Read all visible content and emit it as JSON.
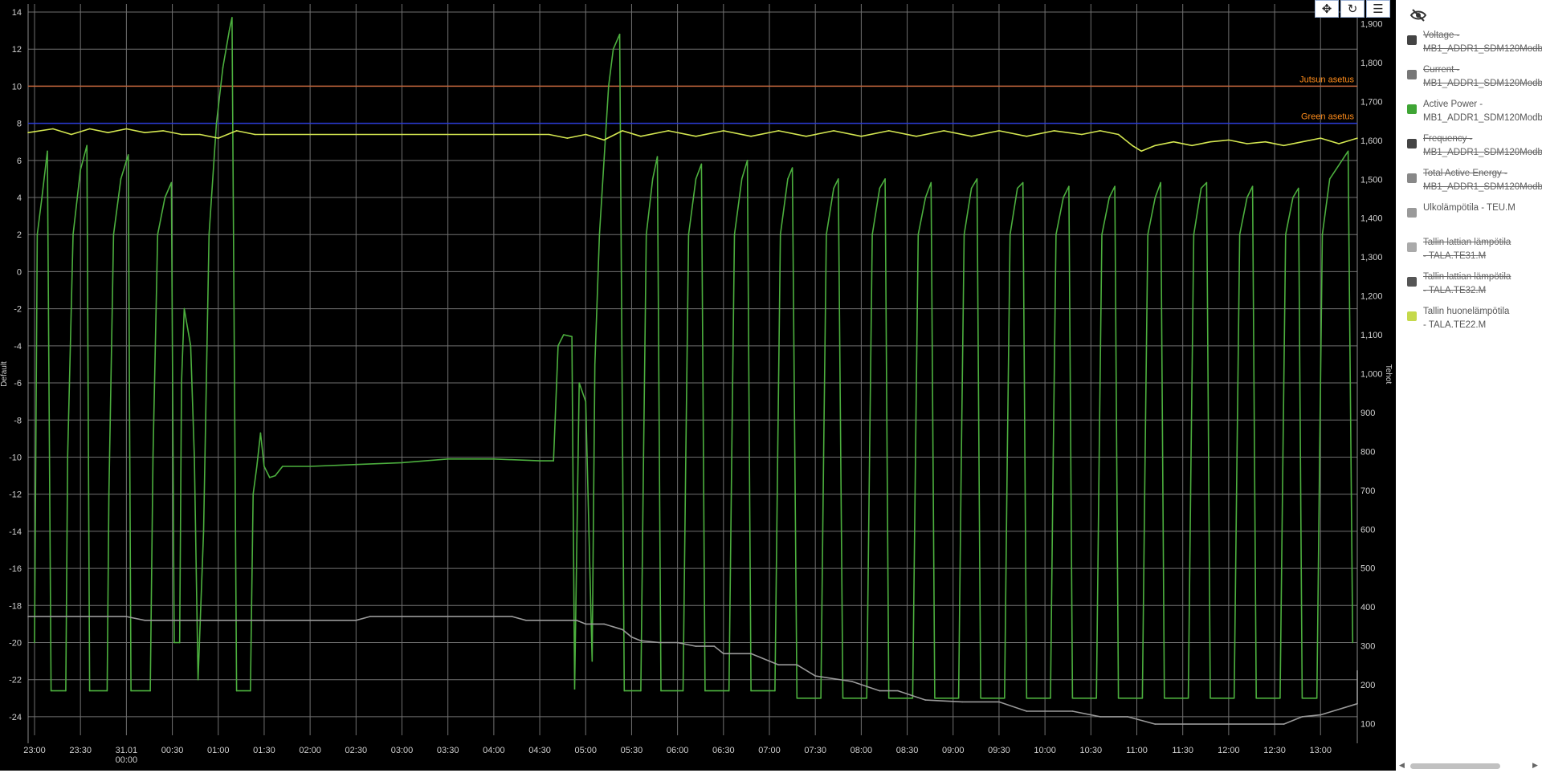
{
  "toolbar": {
    "pan_icon": "move-arrows-icon",
    "reset_icon": "refresh-icon",
    "menu_icon": "hamburger-menu-icon"
  },
  "legend": {
    "toggle_icon": "eye-slash-icon",
    "items": [
      {
        "line1": "Voltage -",
        "line2": "MB1_ADDR1_SDM120Modbus",
        "color": "#444444",
        "hidden": true
      },
      {
        "line1": "Current -",
        "line2": "MB1_ADDR1_SDM120Modbus",
        "color": "#777777",
        "hidden": true
      },
      {
        "line1": "Active Power -",
        "line2": "MB1_ADDR1_SDM120Modbus",
        "color": "#3fa535",
        "hidden": false
      },
      {
        "line1": "Frequency -",
        "line2": "MB1_ADDR1_SDM120Modbus",
        "color": "#444444",
        "hidden": true
      },
      {
        "line1": "Total Active Energy -",
        "line2": "MB1_ADDR1_SDM120Modbus",
        "color": "#888888",
        "hidden": true
      },
      {
        "line1": "Ulkolämpötila - TEU.M",
        "line2": "",
        "color": "#9a9a9a",
        "hidden": false
      },
      {
        "line1": "Tallin lattian lämpötila",
        "line2": "- TALA.TE31.M",
        "color": "#aaaaaa",
        "hidden": true
      },
      {
        "line1": "Tallin lattian lämpötila",
        "line2": "- TALA.TE32.M",
        "color": "#555555",
        "hidden": true
      },
      {
        "line1": "Tallin huonelämpötila",
        "line2": "- TALA.TE22.M",
        "color": "#c5d94b",
        "hidden": false
      }
    ]
  },
  "chart_data": {
    "type": "line",
    "y_left": {
      "title": "Default",
      "ticks": [
        14,
        12,
        10,
        8,
        6,
        4,
        2,
        0,
        -2,
        -4,
        -6,
        -8,
        -10,
        -12,
        -14,
        -16,
        -18,
        -20,
        -22,
        -24
      ],
      "range": [
        -25,
        14
      ]
    },
    "y_right": {
      "title": "Tehot",
      "ticks": [
        1900,
        1800,
        1700,
        1600,
        1500,
        1400,
        1300,
        1200,
        1100,
        1000,
        900,
        800,
        700,
        600,
        500,
        400,
        300,
        200,
        100
      ],
      "range": [
        70,
        1930
      ]
    },
    "x": {
      "ticks": [
        "23:00",
        "23:30",
        "31.01|00:00",
        "00:30",
        "01:00",
        "01:30",
        "02:00",
        "02:30",
        "03:00",
        "03:30",
        "04:00",
        "04:30",
        "05:00",
        "05:30",
        "06:00",
        "06:30",
        "07:00",
        "07:30",
        "08:00",
        "08:30",
        "09:00",
        "09:30",
        "10:00",
        "10:30",
        "11:00",
        "11:30",
        "12:00",
        "12:30",
        "13:00"
      ],
      "range_hours": [
        -0.07,
        14.4
      ]
    },
    "grid": true,
    "legend_placement": "right",
    "plot_lines": [
      {
        "label": "Jutsun asetus",
        "value": 10,
        "color": "#c0643a"
      },
      {
        "label": "Green asetus",
        "value": 8,
        "color": "#2a3bd8"
      }
    ],
    "series": [
      {
        "name": "Active Power - MB1_ADDR1_SDM120Modbus",
        "axis": "left",
        "color": "#4caf3e",
        "points": [
          [
            0.0,
            -20
          ],
          [
            0.03,
            2
          ],
          [
            0.08,
            4
          ],
          [
            0.14,
            6.5
          ],
          [
            0.18,
            -22.6
          ],
          [
            0.34,
            -22.6
          ],
          [
            0.36,
            -10
          ],
          [
            0.42,
            2
          ],
          [
            0.5,
            5.5
          ],
          [
            0.57,
            6.8
          ],
          [
            0.6,
            -22.6
          ],
          [
            0.79,
            -22.6
          ],
          [
            0.81,
            -12
          ],
          [
            0.86,
            2
          ],
          [
            0.94,
            5
          ],
          [
            1.02,
            6.3
          ],
          [
            1.05,
            -22.6
          ],
          [
            1.26,
            -22.6
          ],
          [
            1.29,
            -10
          ],
          [
            1.34,
            2
          ],
          [
            1.42,
            4
          ],
          [
            1.49,
            4.8
          ],
          [
            1.52,
            -20
          ],
          [
            1.58,
            -20
          ],
          [
            1.6,
            -6
          ],
          [
            1.63,
            -2
          ],
          [
            1.7,
            -4
          ],
          [
            1.74,
            -10
          ],
          [
            1.78,
            -22
          ],
          [
            1.84,
            -14
          ],
          [
            1.9,
            2
          ],
          [
            1.98,
            8
          ],
          [
            2.05,
            11
          ],
          [
            2.12,
            13
          ],
          [
            2.15,
            13.7
          ],
          [
            2.2,
            -22.6
          ],
          [
            2.35,
            -22.6
          ],
          [
            2.38,
            -12
          ],
          [
            2.42,
            -10.5
          ],
          [
            2.46,
            -8.7
          ],
          [
            2.5,
            -10.5
          ],
          [
            2.56,
            -11.1
          ],
          [
            2.62,
            -11
          ],
          [
            2.7,
            -10.5
          ],
          [
            3.0,
            -10.5
          ],
          [
            3.5,
            -10.4
          ],
          [
            4.0,
            -10.3
          ],
          [
            4.5,
            -10.1
          ],
          [
            5.0,
            -10.1
          ],
          [
            5.5,
            -10.2
          ],
          [
            5.65,
            -10.2
          ],
          [
            5.7,
            -4
          ],
          [
            5.76,
            -3.4
          ],
          [
            5.85,
            -3.5
          ],
          [
            5.88,
            -22.5
          ],
          [
            5.93,
            -6
          ],
          [
            6.0,
            -7
          ],
          [
            6.07,
            -21
          ],
          [
            6.1,
            -5
          ],
          [
            6.15,
            2
          ],
          [
            6.2,
            6
          ],
          [
            6.25,
            10
          ],
          [
            6.3,
            12
          ],
          [
            6.37,
            12.8
          ],
          [
            6.42,
            -22.6
          ],
          [
            6.6,
            -22.6
          ],
          [
            6.63,
            -10
          ],
          [
            6.66,
            2
          ],
          [
            6.73,
            5
          ],
          [
            6.78,
            6.2
          ],
          [
            6.82,
            -22.6
          ],
          [
            7.06,
            -22.6
          ],
          [
            7.09,
            -10
          ],
          [
            7.12,
            2
          ],
          [
            7.2,
            5
          ],
          [
            7.26,
            5.8
          ],
          [
            7.3,
            -22.6
          ],
          [
            7.56,
            -22.6
          ],
          [
            7.59,
            -10
          ],
          [
            7.62,
            2
          ],
          [
            7.7,
            5
          ],
          [
            7.76,
            6.0
          ],
          [
            7.8,
            -22.6
          ],
          [
            8.06,
            -22.6
          ],
          [
            8.09,
            -10
          ],
          [
            8.12,
            2
          ],
          [
            8.2,
            5
          ],
          [
            8.25,
            5.6
          ],
          [
            8.3,
            -23
          ],
          [
            8.56,
            -23
          ],
          [
            8.59,
            -10
          ],
          [
            8.62,
            2
          ],
          [
            8.7,
            4.5
          ],
          [
            8.75,
            5
          ],
          [
            8.8,
            -23
          ],
          [
            9.06,
            -23
          ],
          [
            9.09,
            -10
          ],
          [
            9.12,
            2
          ],
          [
            9.2,
            4.5
          ],
          [
            9.26,
            5
          ],
          [
            9.3,
            -23
          ],
          [
            9.56,
            -23
          ],
          [
            9.59,
            -10
          ],
          [
            9.62,
            2
          ],
          [
            9.7,
            4
          ],
          [
            9.76,
            4.8
          ],
          [
            9.8,
            -23
          ],
          [
            10.06,
            -23
          ],
          [
            10.09,
            -10
          ],
          [
            10.12,
            2
          ],
          [
            10.2,
            4.5
          ],
          [
            10.26,
            5
          ],
          [
            10.3,
            -23
          ],
          [
            10.56,
            -23
          ],
          [
            10.59,
            -10
          ],
          [
            10.62,
            2
          ],
          [
            10.7,
            4.5
          ],
          [
            10.76,
            4.8
          ],
          [
            10.8,
            -23
          ],
          [
            11.06,
            -23
          ],
          [
            11.09,
            -10
          ],
          [
            11.12,
            2
          ],
          [
            11.2,
            4
          ],
          [
            11.26,
            4.6
          ],
          [
            11.3,
            -23
          ],
          [
            11.56,
            -23
          ],
          [
            11.59,
            -10
          ],
          [
            11.62,
            2
          ],
          [
            11.7,
            4
          ],
          [
            11.76,
            4.6
          ],
          [
            11.8,
            -23
          ],
          [
            12.06,
            -23
          ],
          [
            12.09,
            -10
          ],
          [
            12.12,
            2
          ],
          [
            12.2,
            4
          ],
          [
            12.26,
            4.8
          ],
          [
            12.3,
            -23
          ],
          [
            12.56,
            -23
          ],
          [
            12.59,
            -10
          ],
          [
            12.62,
            2
          ],
          [
            12.7,
            4.5
          ],
          [
            12.76,
            4.8
          ],
          [
            12.8,
            -23
          ],
          [
            13.06,
            -23
          ],
          [
            13.09,
            -10
          ],
          [
            13.12,
            2
          ],
          [
            13.2,
            4
          ],
          [
            13.26,
            4.6
          ],
          [
            13.3,
            -23
          ],
          [
            13.56,
            -23
          ],
          [
            13.59,
            -10
          ],
          [
            13.62,
            2
          ],
          [
            13.7,
            4
          ],
          [
            13.76,
            4.5
          ],
          [
            13.8,
            -23
          ],
          [
            13.96,
            -23
          ],
          [
            13.99,
            -10
          ],
          [
            14.02,
            2
          ],
          [
            14.1,
            5
          ],
          [
            14.3,
            6.5
          ],
          [
            14.35,
            -20
          ]
        ]
      },
      {
        "name": "Ulkolämpötila - TEU.M",
        "axis": "left",
        "color": "#9a9a9a",
        "points": [
          [
            -0.07,
            -18.6
          ],
          [
            1.0,
            -18.6
          ],
          [
            1.2,
            -18.8
          ],
          [
            3.5,
            -18.8
          ],
          [
            3.65,
            -18.6
          ],
          [
            5.2,
            -18.6
          ],
          [
            5.35,
            -18.8
          ],
          [
            5.9,
            -18.8
          ],
          [
            6.0,
            -19.0
          ],
          [
            6.2,
            -19.0
          ],
          [
            6.4,
            -19.3
          ],
          [
            6.5,
            -19.7
          ],
          [
            6.6,
            -19.9
          ],
          [
            6.8,
            -20.0
          ],
          [
            7.0,
            -20.0
          ],
          [
            7.2,
            -20.2
          ],
          [
            7.4,
            -20.2
          ],
          [
            7.5,
            -20.6
          ],
          [
            7.8,
            -20.6
          ],
          [
            8.1,
            -21.2
          ],
          [
            8.3,
            -21.2
          ],
          [
            8.5,
            -21.8
          ],
          [
            8.9,
            -22.1
          ],
          [
            9.2,
            -22.6
          ],
          [
            9.4,
            -22.6
          ],
          [
            9.7,
            -23.1
          ],
          [
            10.1,
            -23.2
          ],
          [
            10.5,
            -23.2
          ],
          [
            10.8,
            -23.7
          ],
          [
            11.3,
            -23.7
          ],
          [
            11.6,
            -24.0
          ],
          [
            11.9,
            -24.0
          ],
          [
            12.2,
            -24.4
          ],
          [
            13.0,
            -24.4
          ],
          [
            13.6,
            -24.4
          ],
          [
            13.8,
            -24.0
          ],
          [
            14.0,
            -23.9
          ],
          [
            14.4,
            -23.3
          ],
          [
            14.8,
            -22.4
          ],
          [
            15.1,
            -22.3
          ],
          [
            15.4,
            -21.8
          ],
          [
            15.7,
            -21.5
          ],
          [
            16.0,
            -21.5
          ]
        ]
      },
      {
        "name": "Tallin huonelämpötila - TALA.TE22.M",
        "axis": "left",
        "color": "#d3e650",
        "points": [
          [
            -0.07,
            7.5
          ],
          [
            0.2,
            7.7
          ],
          [
            0.4,
            7.4
          ],
          [
            0.6,
            7.7
          ],
          [
            0.8,
            7.5
          ],
          [
            1.0,
            7.7
          ],
          [
            1.2,
            7.5
          ],
          [
            1.4,
            7.6
          ],
          [
            1.6,
            7.4
          ],
          [
            1.8,
            7.4
          ],
          [
            2.0,
            7.2
          ],
          [
            2.2,
            7.6
          ],
          [
            2.4,
            7.4
          ],
          [
            3.0,
            7.4
          ],
          [
            4.0,
            7.4
          ],
          [
            5.0,
            7.4
          ],
          [
            5.6,
            7.4
          ],
          [
            5.8,
            7.2
          ],
          [
            6.0,
            7.4
          ],
          [
            6.2,
            7.1
          ],
          [
            6.4,
            7.6
          ],
          [
            6.6,
            7.3
          ],
          [
            6.9,
            7.6
          ],
          [
            7.2,
            7.3
          ],
          [
            7.5,
            7.6
          ],
          [
            7.8,
            7.3
          ],
          [
            8.1,
            7.6
          ],
          [
            8.4,
            7.3
          ],
          [
            8.7,
            7.6
          ],
          [
            9.0,
            7.3
          ],
          [
            9.3,
            7.6
          ],
          [
            9.6,
            7.3
          ],
          [
            9.9,
            7.6
          ],
          [
            10.2,
            7.3
          ],
          [
            10.5,
            7.6
          ],
          [
            10.8,
            7.3
          ],
          [
            11.1,
            7.6
          ],
          [
            11.4,
            7.4
          ],
          [
            11.6,
            7.6
          ],
          [
            11.8,
            7.4
          ],
          [
            11.95,
            6.8
          ],
          [
            12.05,
            6.5
          ],
          [
            12.2,
            6.8
          ],
          [
            12.4,
            7.0
          ],
          [
            12.6,
            6.8
          ],
          [
            12.8,
            7.0
          ],
          [
            13.0,
            7.1
          ],
          [
            13.2,
            6.9
          ],
          [
            13.4,
            7.0
          ],
          [
            13.6,
            6.8
          ],
          [
            13.8,
            7.0
          ],
          [
            14.0,
            7.2
          ],
          [
            14.2,
            6.9
          ],
          [
            14.4,
            7.2
          ]
        ]
      }
    ]
  }
}
